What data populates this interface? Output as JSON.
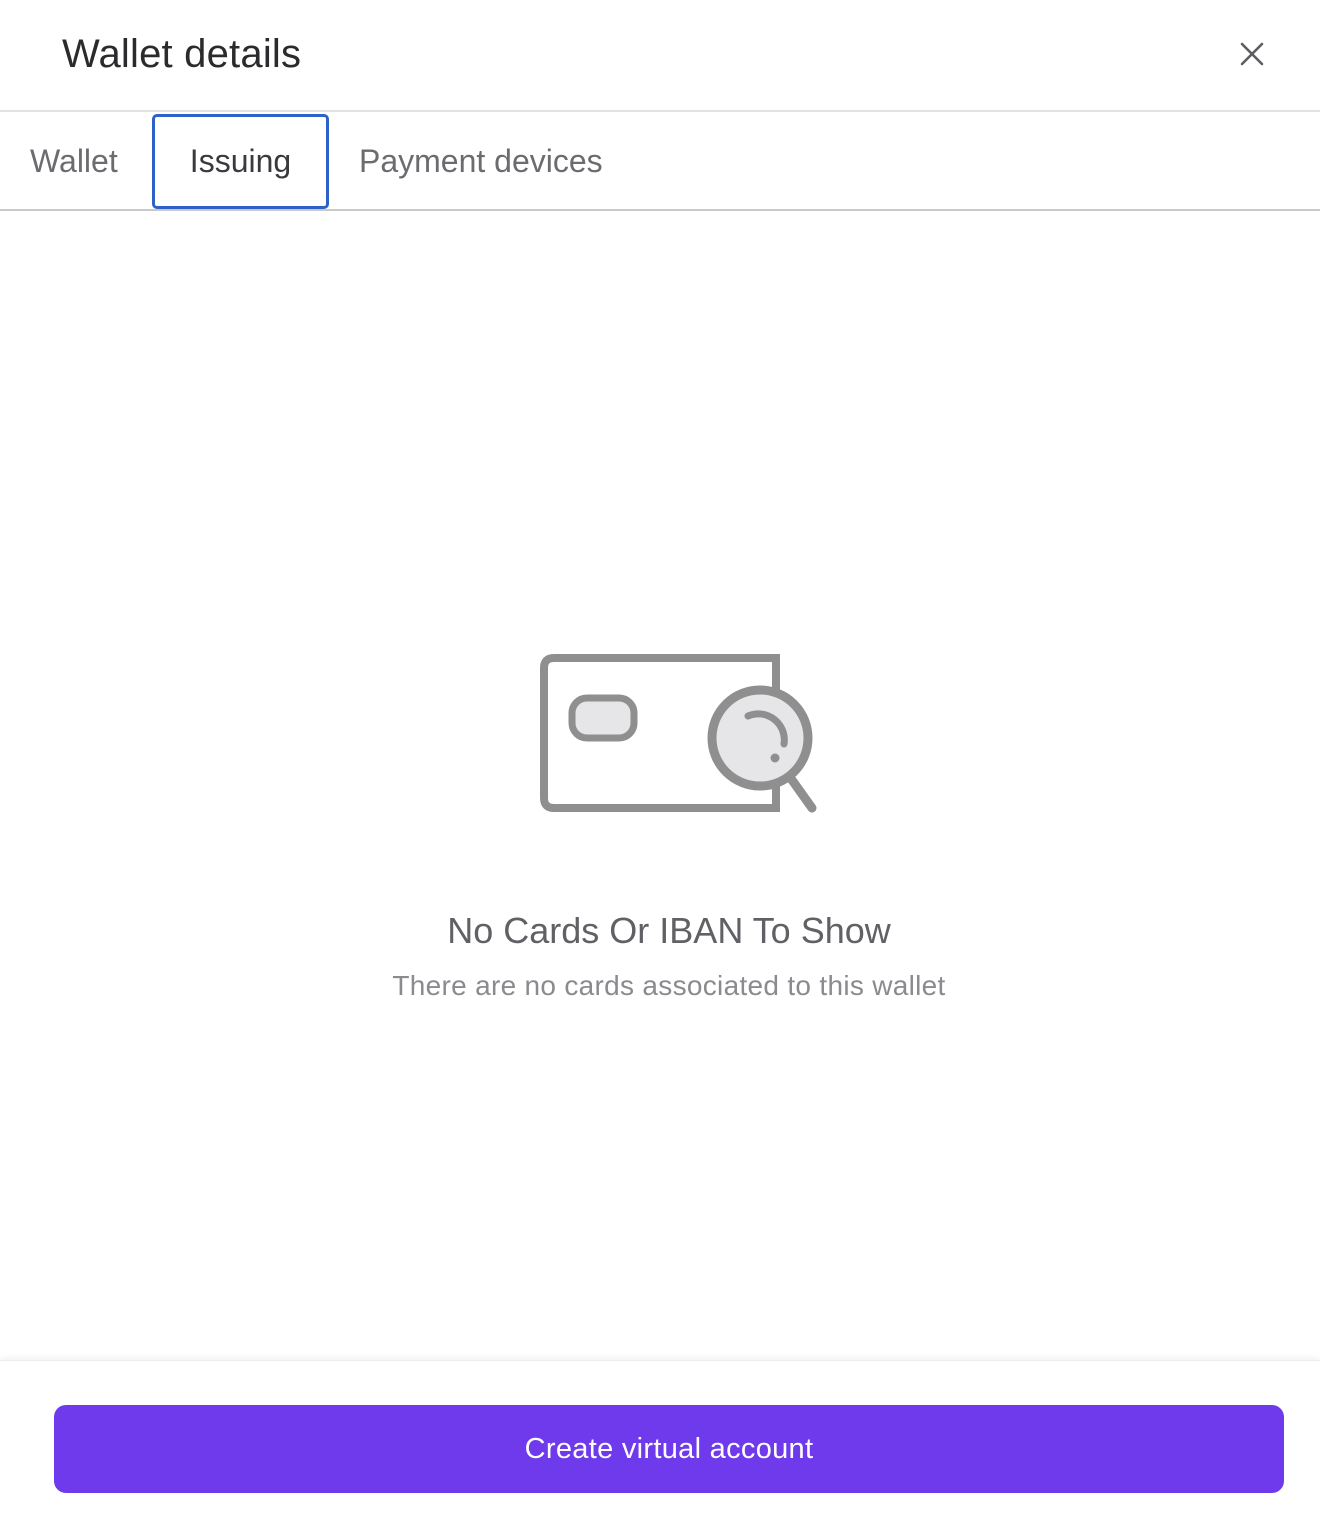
{
  "header": {
    "title": "Wallet details",
    "close_icon": "close-icon"
  },
  "tabs": [
    {
      "label": "Wallet",
      "selected": false
    },
    {
      "label": "Issuing",
      "selected": true
    },
    {
      "label": "Payment devices",
      "selected": false
    }
  ],
  "empty_state": {
    "icon": "card-search-icon",
    "title": "No Cards Or IBAN To Show",
    "subtitle": "There are no cards associated to this wallet"
  },
  "footer": {
    "button_label": "Create virtual account"
  },
  "colors": {
    "accent": "#6e3aec",
    "tab_focus": "#2e62c9",
    "icon_gray": "#8f8f8f",
    "icon_fill": "#e6e6e8"
  }
}
